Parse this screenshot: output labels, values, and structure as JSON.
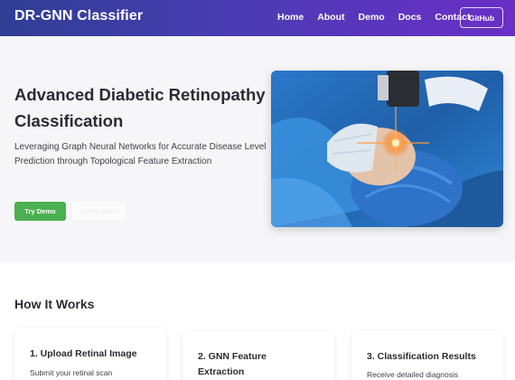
{
  "brand": "DR-GNN Classifier",
  "nav": {
    "links": [
      "Home",
      "About",
      "Demo",
      "Docs",
      "Contact"
    ],
    "github_label": "GitHub"
  },
  "hero": {
    "title": "Advanced Diabetic Retinopathy Classification",
    "subtitle": "Leveraging Graph Neural Networks for Accurate Disease Level Prediction through Topological Feature Extraction",
    "primary_button": "Try Demo",
    "secondary_button": "Learn More",
    "image_icon": "retinal-eye-exam-photo"
  },
  "how_it_works": {
    "title": "How It Works",
    "cards": [
      {
        "title": "1. Upload Retinal Image",
        "text": "Submit your retinal scan"
      },
      {
        "title": "2. GNN Feature Extraction",
        "text": ""
      },
      {
        "title": "3. Classification Results",
        "text": "Receive detailed diagnosis"
      }
    ]
  },
  "colors": {
    "nav_start": "#2f3e93",
    "nav_end": "#6a2fc7",
    "primary_button": "#4caf50",
    "hero_bg": "#f6f6f8"
  }
}
